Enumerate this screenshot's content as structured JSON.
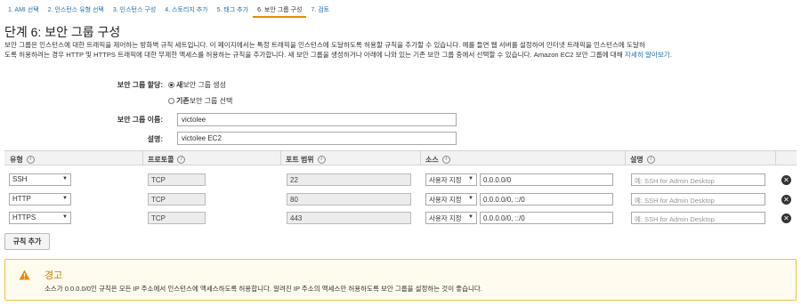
{
  "steps": [
    {
      "label": "1. AMI 선택"
    },
    {
      "label": "2. 인스턴스 유형 선택"
    },
    {
      "label": "3. 인스턴스 구성"
    },
    {
      "label": "4. 스토리지 추가"
    },
    {
      "label": "5. 태그 추가"
    },
    {
      "label": "6. 보안 그룹 구성",
      "active": true
    },
    {
      "label": "7. 검토"
    }
  ],
  "page": {
    "title": "단계 6: 보안 그룹 구성",
    "desc_line1": "보안 그룹은 인스턴스에 대한 트래픽을 제어하는 방화벽 규칙 세트입니다. 이 페이지에서는 특정 트래픽을 인스턴스에 도달하도록 허용할 규칙을 추가할 수 있습니다. 예를 들면 웹 서버를 설정하여 인터넷 트래픽을 인스턴스에 도달하",
    "desc_line2": "도록 허용하려는 경우 HTTP 및 HTTPS 트래픽에 대한 무제한 액세스를 허용하는 규칙을 추가합니다. 새 보안 그룹을 생성하거나 아래에 나와 있는 기존 보안 그룹 중에서 선택할 수 있습니다. Amazon EC2 보안 그룹에 대해 ",
    "desc_link": "자세히 알아보기",
    "desc_end": "."
  },
  "form": {
    "assign_label": "보안 그룹 할당:",
    "new_bold": "새",
    "new_rest": " 보안 그룹 생성",
    "existing_bold": "기존",
    "existing_rest": " 보안 그룹 선택",
    "name_label": "보안 그룹 이름:",
    "name_value": "victolee",
    "desc_label": "설명:",
    "desc_value": "victolee EC2"
  },
  "table": {
    "headers": {
      "type": "유형",
      "protocol": "프로토콜",
      "port": "포트 범위",
      "source": "소스",
      "description": "설명"
    },
    "info_glyph": "i",
    "rows": [
      {
        "type": "SSH",
        "protocol": "TCP",
        "port": "22",
        "source_mode": "사용자 지정",
        "source": "0.0.0.0/0",
        "desc_placeholder": "예: SSH for Admin Desktop"
      },
      {
        "type": "HTTP",
        "protocol": "TCP",
        "port": "80",
        "source_mode": "사용자 지정",
        "source": "0.0.0.0/0, ::/0",
        "desc_placeholder": "예: SSH for Admin Desktop"
      },
      {
        "type": "HTTPS",
        "protocol": "TCP",
        "port": "443",
        "source_mode": "사용자 지정",
        "source": "0.0.0.0/0, ::/0",
        "desc_placeholder": "예: SSH for Admin Desktop"
      }
    ],
    "delete_glyph": "✕",
    "add_rule_label": "규칙 추가"
  },
  "warning": {
    "title": "경고",
    "text": "소스가 0.0.0.0/0인 규칙은 모든 IP 주소에서 인스턴스에 액세스하도록 허용합니다. 알려진 IP 주소의 액세스만 허용하도록 보안 그룹을 설정하는 것이 좋습니다.",
    "icon": "warning-triangle-icon",
    "color": "#e68a00"
  },
  "colors": {
    "link": "#1f6fb3",
    "active_step_underline": "#e68a00",
    "warning_border": "#f0c040"
  }
}
